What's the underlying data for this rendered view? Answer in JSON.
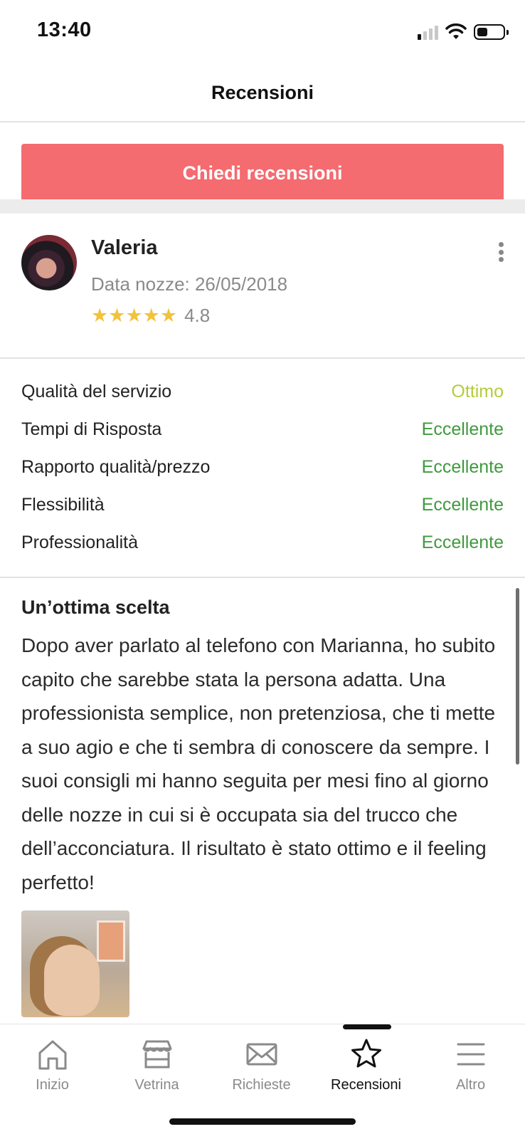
{
  "status_bar": {
    "time": "13:40",
    "signal_bars_active": 1,
    "battery_level": 0.4
  },
  "header": {
    "title": "Recensioni"
  },
  "cta": {
    "label": "Chiedi recensioni",
    "color": "#f46b70"
  },
  "reviewer": {
    "name": "Valeria",
    "wedding_date": "Data nozze: 26/05/2018",
    "stars": 5,
    "rating": "4.8"
  },
  "ratings": [
    {
      "label": "Qualità del servizio",
      "score": "Ottimo",
      "color": "#b5cc3a"
    },
    {
      "label": "Tempi di Risposta",
      "score": "Eccellente",
      "color": "#3f9a3f"
    },
    {
      "label": "Rapporto qualità/prezzo",
      "score": "Eccellente",
      "color": "#3f9a3f"
    },
    {
      "label": "Flessibilità",
      "score": "Eccellente",
      "color": "#3f9a3f"
    },
    {
      "label": "Professionalità",
      "score": "Eccellente",
      "color": "#3f9a3f"
    }
  ],
  "review": {
    "title": "Un’ottima scelta",
    "text": "Dopo aver parlato al telefono con Marianna, ho subito capito che sarebbe stata la persona adatta. Una professionista semplice, non pretenziosa, che ti mette a suo agio e che ti sembra di conoscere da sempre. I suoi consigli mi hanno seguita per mesi fino al giorno delle nozze in cui si è occupata sia del trucco che dell’acconciatura. Il risultato è stato ottimo e il feeling perfetto!"
  },
  "tabs": [
    {
      "label": "Inizio",
      "icon": "home-icon",
      "active": false
    },
    {
      "label": "Vetrina",
      "icon": "storefront-icon",
      "active": false
    },
    {
      "label": "Richieste",
      "icon": "mail-icon",
      "active": false
    },
    {
      "label": "Recensioni",
      "icon": "star-icon",
      "active": true
    },
    {
      "label": "Altro",
      "icon": "menu-icon",
      "active": false
    }
  ]
}
